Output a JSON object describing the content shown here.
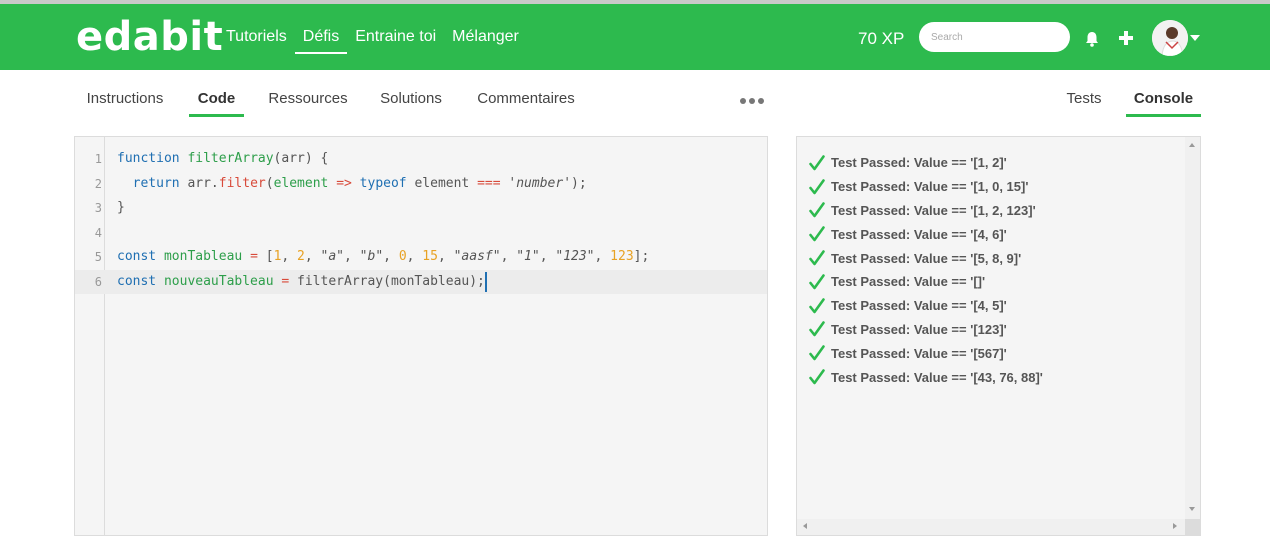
{
  "brand": "edabit",
  "nav": {
    "items": [
      {
        "label": "Tutoriels"
      },
      {
        "label": "Défis"
      },
      {
        "label": "Entraine toi"
      },
      {
        "label": "Mélanger"
      }
    ],
    "active": "Défis"
  },
  "header": {
    "xp": "70 XP",
    "search_placeholder": "Search"
  },
  "tabs": {
    "left": [
      "Instructions",
      "Code",
      "Ressources",
      "Solutions",
      "Commentaires"
    ],
    "right": [
      "Tests",
      "Console"
    ],
    "active_left": "Code",
    "active_right": "Console"
  },
  "editor": {
    "line_numbers": [
      "1",
      "2",
      "3",
      "4",
      "5",
      "6"
    ],
    "current_line": 6
  },
  "console": {
    "results": [
      "Test Passed: Value == '[1, 2]'",
      "Test Passed: Value == '[1, 0, 15]'",
      "Test Passed: Value == '[1, 2, 123]'",
      "Test Passed: Value == '[4, 6]'",
      "Test Passed: Value == '[5, 8, 9]'",
      "Test Passed: Value == '[]'",
      "Test Passed: Value == '[4, 5]'",
      "Test Passed: Value == '[123]'",
      "Test Passed: Value == '[567]'",
      "Test Passed: Value == '[43, 76, 88]'"
    ]
  },
  "colors": {
    "brand_green": "#2dba4e",
    "check_green": "#2dba4e",
    "keyword_blue": "#1f6fb2",
    "number_orange": "#e8a224"
  },
  "icons": {
    "notifications": "bell-icon",
    "create": "plus-icon",
    "menu": "chevron-down-icon",
    "more": "more-dots-icon",
    "pass": "check-icon"
  }
}
